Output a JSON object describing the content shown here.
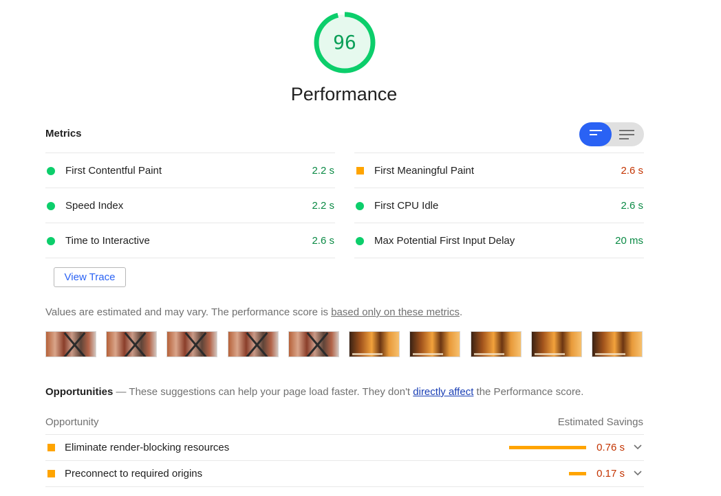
{
  "category": {
    "score": "96",
    "score_value": 0.96,
    "title": "Performance",
    "colors": {
      "pass": "#0cce6b",
      "average": "#ffa400",
      "accent": "#2a62f4"
    }
  },
  "metrics": {
    "heading": "Metrics",
    "toggle": {
      "icons": [
        "summary-view-icon",
        "list-view-icon"
      ],
      "selected": "summary"
    },
    "left": [
      {
        "label": "First Contentful Paint",
        "value": "2.2 s",
        "rating": "pass"
      },
      {
        "label": "Speed Index",
        "value": "2.2 s",
        "rating": "pass"
      },
      {
        "label": "Time to Interactive",
        "value": "2.6 s",
        "rating": "pass"
      }
    ],
    "right": [
      {
        "label": "First Meaningful Paint",
        "value": "2.6 s",
        "rating": "average"
      },
      {
        "label": "First CPU Idle",
        "value": "2.6 s",
        "rating": "pass"
      },
      {
        "label": "Max Potential First Input Delay",
        "value": "20 ms",
        "rating": "pass"
      }
    ],
    "view_trace": "View Trace"
  },
  "note": {
    "prefix": "Values are estimated and may vary. The performance score is ",
    "link": "based only on these metrics",
    "suffix": "."
  },
  "filmstrip": {
    "frames": [
      "screenshot-thumbnail",
      "screenshot-thumbnail",
      "screenshot-thumbnail",
      "screenshot-thumbnail",
      "screenshot-thumbnail",
      "screenshot-thumbnail",
      "screenshot-thumbnail",
      "screenshot-thumbnail",
      "screenshot-thumbnail",
      "screenshot-thumbnail"
    ]
  },
  "opportunities": {
    "heading": "Opportunities",
    "dash": " — ",
    "desc_prefix": "These suggestions can help your page load faster. They don't ",
    "desc_link": "directly affect",
    "desc_suffix": " the Performance score.",
    "col_left": "Opportunity",
    "col_right": "Estimated Savings",
    "items": [
      {
        "label": "Eliminate render-blocking resources",
        "savings": "0.76 s",
        "savings_seconds": 0.76
      },
      {
        "label": "Preconnect to required origins",
        "savings": "0.17 s",
        "savings_seconds": 0.17
      }
    ]
  }
}
